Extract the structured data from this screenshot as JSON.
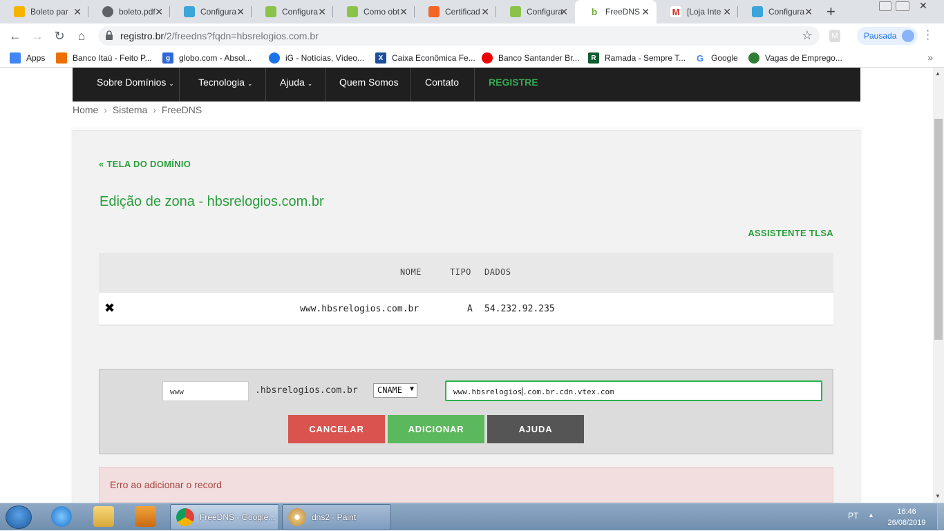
{
  "browser": {
    "tabs": [
      {
        "title": "Boleto par",
        "color": "#f4b400"
      },
      {
        "title": "boleto.pdf",
        "color": "#5f6368"
      },
      {
        "title": "Configura",
        "color": "#3ba4d8"
      },
      {
        "title": "Configura",
        "color": "#8bc34a"
      },
      {
        "title": "Como obt",
        "color": "#8bc34a"
      },
      {
        "title": "Certificad",
        "color": "#f26522"
      },
      {
        "title": "Configura",
        "color": "#8bc34a"
      },
      {
        "title": "FreeDNS",
        "color": "#6fb23a"
      },
      {
        "title": "[Loja Inte",
        "color": "#d93025"
      },
      {
        "title": "Configura",
        "color": "#3ba4d8"
      }
    ],
    "url_host": "registro.br",
    "url_path": "/2/freedns?fqdn=hbsrelogios.com.br",
    "profile_label": "Pausada",
    "bookmarks": [
      {
        "label": "Apps",
        "color": "#4285f4"
      },
      {
        "label": "Banco Itaú - Feito P...",
        "color": "#ec7000"
      },
      {
        "label": "globo.com - Absol...",
        "color": "#2f68d8"
      },
      {
        "label": "iG - Notícias, Vídeo...",
        "color": "#1a73e8"
      },
      {
        "label": "Caixa Econômica Fe...",
        "color": "#1b4f9c"
      },
      {
        "label": "Banco Santander Br...",
        "color": "#ec0000"
      },
      {
        "label": "Ramada - Sempre T...",
        "color": "#0f5c2e"
      },
      {
        "label": "Google",
        "color": "#4285f4"
      },
      {
        "label": "Vagas de Emprego...",
        "color": "#2e7d32"
      }
    ]
  },
  "site_nav": {
    "items": [
      "Sobre Domínios",
      "Tecnologia",
      "Ajuda",
      "Quem Somos",
      "Contato",
      "REGISTRE"
    ]
  },
  "breadcrumb": [
    "Home",
    "Sistema",
    "FreeDNS"
  ],
  "page": {
    "back_link": "« TELA DO DOMÍNIO",
    "title": "Edição de zona - hbsrelogios.com.br",
    "tlsa_link": "ASSISTENTE TLSA",
    "table_headers": {
      "name": "NOME",
      "type": "TIPO",
      "data": "DADOS"
    },
    "records": [
      {
        "name": "www.hbsrelogios.com.br",
        "type": "A",
        "data": "54.232.92.235"
      }
    ],
    "form": {
      "name_value": "www",
      "domain_suffix": ".hbsrelogios.com.br",
      "type_value": "CNAME",
      "data_value_before_caret": "www.hbsrelogios",
      "data_value_after_caret": ".com.br.cdn.vtex.com",
      "cancel_label": "CANCELAR",
      "add_label": "ADICIONAR",
      "help_label": "AJUDA"
    },
    "error_message": "Erro ao adicionar o record"
  },
  "taskbar": {
    "tasks": [
      "FreeDNS - Google...",
      "dns2 - Paint"
    ],
    "language": "PT",
    "time": "16:46",
    "date": "26/08/2019"
  }
}
